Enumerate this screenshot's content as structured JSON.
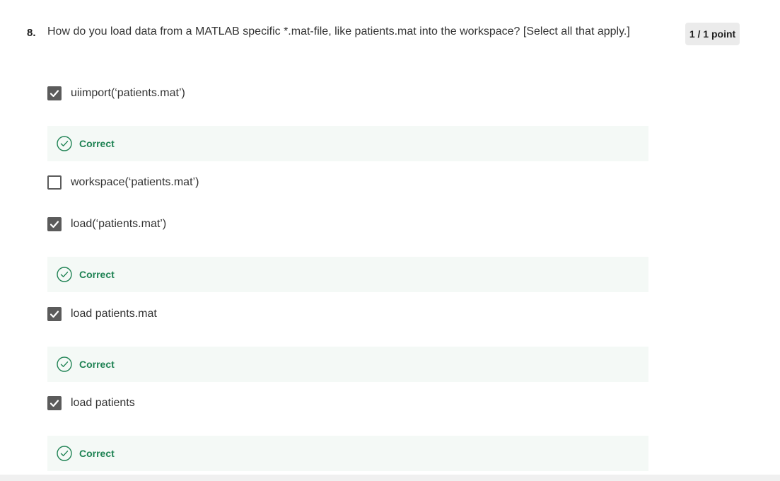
{
  "question": {
    "number": "8.",
    "text": "How do you load data from a MATLAB specific *.mat-file, like patients.mat into the workspace? [Select all that apply.]",
    "points": "1 / 1 point"
  },
  "options": [
    {
      "label": "uiimport(‘patients.mat’)",
      "checked": true
    },
    {
      "label": "workspace(‘patients.mat’)",
      "checked": false
    },
    {
      "label": "load(‘patients.mat’)",
      "checked": true
    },
    {
      "label": "load patients.mat",
      "checked": true
    },
    {
      "label": "load patients",
      "checked": true
    }
  ],
  "feedback": [
    {
      "label": "Correct"
    },
    {
      "label": "Correct"
    },
    {
      "label": "Correct"
    },
    {
      "label": "Correct"
    }
  ],
  "colors": {
    "correct": "#1f8354",
    "feedback_bg": "#f4f9f6",
    "checkbox": "#5b5b5b",
    "badge_bg": "#ebebeb"
  },
  "icons": {
    "checked": "checkmark-icon",
    "feedback": "check-circle-icon"
  }
}
